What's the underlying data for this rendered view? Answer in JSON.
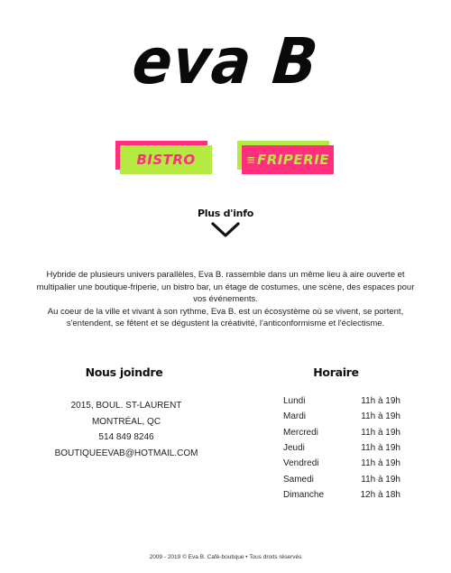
{
  "brand": {
    "logo_text": "eva B"
  },
  "categories": [
    {
      "label": "BISTRO",
      "color_bg": "#b5ea42",
      "color_text": "#ff2f7e"
    },
    {
      "label": "FRIPERIE",
      "color_bg": "#ff2f7e",
      "color_text": "#b5ea42"
    }
  ],
  "more_info": {
    "label": "Plus d'info",
    "icon": "chevron-down-icon"
  },
  "description": {
    "paragraph_1": "Hybride de plusieurs univers parallèles, Eva B. rassemble dans un même lieu à aire ouverte et multipalier une boutique-friperie, un bistro bar, un étage de costumes, une scène, des espaces pour vos événements.",
    "paragraph_2": "Au coeur de la ville et vivant à son rythme, Eva B. est un écosystème où se vivent, se portent, s'entendent, se fêtent et se dégustent la créativité, l'anticonformisme et l'éclectisme."
  },
  "contact": {
    "heading": "Nous joindre",
    "address_line1": "2015, BOUL. ST-LAURENT",
    "address_line2": "MONTRÉAL, QC",
    "phone": "514 849 8246",
    "email": "BOUTIQUEEVAB@HOTMAIL.COM"
  },
  "hours": {
    "heading": "Horaire",
    "rows": [
      {
        "day": "Lundi",
        "time": "11h à 19h"
      },
      {
        "day": "Mardi",
        "time": "11h à 19h"
      },
      {
        "day": "Mercredi",
        "time": "11h à 19h"
      },
      {
        "day": "Jeudi",
        "time": "11h à 19h"
      },
      {
        "day": "Vendredi",
        "time": "11h à 19h"
      },
      {
        "day": "Samedi",
        "time": "11h à 19h"
      },
      {
        "day": "Dimanche",
        "time": "12h à 18h"
      }
    ]
  },
  "footer": {
    "text": "2009 - 2019 © Eva B. Café-boutique • Tous droits réservés"
  }
}
